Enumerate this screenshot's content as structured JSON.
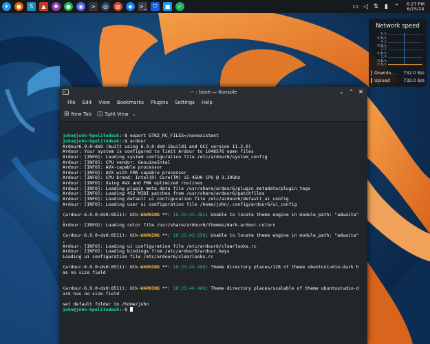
{
  "colors": {
    "accent": "#3daee9",
    "prompt_green": "#1cdc9a",
    "warning": "#fdbc4b",
    "download_swatch": "#3b7fd1",
    "upload_swatch": "#f39c1f"
  },
  "panel": {
    "apps": [
      {
        "name": "kde-logo-icon",
        "glyph": "✦",
        "color": "#1d99f3",
        "square": false
      },
      {
        "name": "firefox-icon",
        "glyph": "●",
        "color": "#e66000",
        "square": false
      },
      {
        "name": "s-app-icon",
        "glyph": "S",
        "color": "#1e8bc3",
        "square": true
      },
      {
        "name": "red-triangle-icon",
        "glyph": "▲",
        "color": "#c0392b",
        "square": true
      },
      {
        "name": "pinwheel-icon",
        "glyph": "✺",
        "color": "#8e44ad",
        "square": false
      },
      {
        "name": "spotify-icon",
        "glyph": "●",
        "color": "#1db954",
        "square": false
      },
      {
        "name": "discord-icon",
        "glyph": "◉",
        "color": "#5865f2",
        "square": false
      },
      {
        "name": "terminal-icon",
        "glyph": ">",
        "color": "#31363b",
        "square": true
      },
      {
        "name": "steam-icon",
        "glyph": "◎",
        "color": "#2a475e",
        "square": false
      },
      {
        "name": "chrome-icon",
        "glyph": "◍",
        "color": "#db4437",
        "square": false
      },
      {
        "name": "thunderbird-icon",
        "glyph": "◆",
        "color": "#0a84ff",
        "square": false
      },
      {
        "name": "konsole-active-icon",
        "glyph": ">_",
        "color": "#3b4046",
        "square": true
      },
      {
        "name": "bitwarden-icon",
        "glyph": "⛉",
        "color": "#175ddc",
        "square": true
      },
      {
        "name": "blue-app-icon",
        "glyph": "■",
        "color": "#1d99f3",
        "square": true
      },
      {
        "name": "green-app-icon",
        "glyph": "✓",
        "color": "#27ae60",
        "square": false
      }
    ],
    "tray": [
      {
        "name": "display-icon",
        "glyph": "▭"
      },
      {
        "name": "volume-icon",
        "glyph": "◁"
      },
      {
        "name": "network-icon",
        "glyph": "⇅"
      },
      {
        "name": "battery-icon",
        "glyph": "▮"
      },
      {
        "name": "expand-tray-icon",
        "glyph": "⌃"
      }
    ],
    "clock_time": "6:27 PM",
    "clock_date": "6/15/24"
  },
  "network_widget": {
    "title": "Network speed",
    "grid_labels": [
      "5.5 KiB/s",
      "4.1 KiB/s",
      "2.7 KiB/s",
      "1.4 KiB/s",
      "0 B/s"
    ],
    "download_label": "Downlo...",
    "download_value": "732.0 B/s",
    "upload_label": "Upload",
    "upload_value": "732.0 B/s"
  },
  "window": {
    "title": "~ : bash — Konsole",
    "menu": [
      "File",
      "Edit",
      "View",
      "Bookmarks",
      "Plugins",
      "Settings",
      "Help"
    ],
    "toolbar": {
      "new_tab": "New Tab",
      "split_view": "Split View"
    }
  },
  "terminal": {
    "lines": [
      [
        {
          "t": "john@john-hpelitedesk",
          "c": "c-green"
        },
        {
          "t": ":",
          "c": "c-white"
        },
        {
          "t": "~",
          "c": "c-blue"
        },
        {
          "t": "$ export GTK2_RC_FILES=/nonexistent",
          "c": "c-white"
        }
      ],
      [
        {
          "t": "john@john-hpelitedesk",
          "c": "c-green"
        },
        {
          "t": ":",
          "c": "c-white"
        },
        {
          "t": "~",
          "c": "c-blue"
        },
        {
          "t": "$ ardour",
          "c": "c-white"
        }
      ],
      [
        {
          "t": "Ardour6.9.0~ds0 (built using 6.9.0-ds0-1build1 and GCC version 11.2.0)",
          "c": "c-white"
        }
      ],
      [
        {
          "t": "Ardour: Your system is configured to limit Ardour to 1048576 open files",
          "c": "c-white"
        }
      ],
      [
        {
          "t": "Ardour: [INFO]: Loading system configuration file /etc/ardour6/system_config",
          "c": "c-white"
        }
      ],
      [
        {
          "t": "Ardour: [INFO]: CPU vendor: GenuineIntel",
          "c": "c-white"
        }
      ],
      [
        {
          "t": "Ardour: [INFO]: AVX-capable processor",
          "c": "c-white"
        }
      ],
      [
        {
          "t": "Ardour: [INFO]: AVX with FMA capable processor",
          "c": "c-white"
        }
      ],
      [
        {
          "t": "Ardour: [INFO]: CPU brand: Intel(R) Core(TM) i5-4590 CPU @ 3.30GHz",
          "c": "c-white"
        }
      ],
      [
        {
          "t": "Ardour: [INFO]: Using AVX and FMA optimized routines",
          "c": "c-white"
        }
      ],
      [
        {
          "t": "Ardour: [INFO]: Loading plugin meta data file /usr/share/ardour6/plugin_metadata/plugin_tags",
          "c": "c-white"
        }
      ],
      [
        {
          "t": "Ardour: [INFO]: Loading 452 MIDI patches from /usr/share/ardour6/patchfiles",
          "c": "c-white"
        }
      ],
      [
        {
          "t": "Ardour: [INFO]: Loading default ui configuration file /etc/ardour6/default_ui_config",
          "c": "c-white"
        }
      ],
      [
        {
          "t": "Ardour: [INFO]: Loading user ui configuration file /home/john/.config/ardour6/ui_config",
          "c": "c-white"
        }
      ],
      [
        {
          "t": "",
          "c": "c-white"
        }
      ],
      [
        {
          "t": "(ardour-6.9.0~ds0:8511): Gtk-",
          "c": "c-white"
        },
        {
          "t": "WARNING",
          "c": "c-warn"
        },
        {
          "t": " **: ",
          "c": "c-white"
        },
        {
          "t": "18:25:43.461",
          "c": "c-cyan"
        },
        {
          "t": ": Unable to locate theme engine in module_path: \"adwaita\"",
          "c": "c-white"
        }
      ],
      [
        {
          "t": ",",
          "c": "c-white"
        }
      ],
      [
        {
          "t": "Ardour: [INFO]: Loading color file /usr/share/ardour6/themes/dark-ardour.colors",
          "c": "c-white"
        }
      ],
      [
        {
          "t": "",
          "c": "c-white"
        }
      ],
      [
        {
          "t": "(ardour-6.9.0~ds0:8511): Gtk-",
          "c": "c-white"
        },
        {
          "t": "WARNING",
          "c": "c-warn"
        },
        {
          "t": " **: ",
          "c": "c-white"
        },
        {
          "t": "18:25:43.658",
          "c": "c-cyan"
        },
        {
          "t": ": Unable to locate theme engine in module_path: \"adwaita\"",
          "c": "c-white"
        }
      ],
      [
        {
          "t": ",",
          "c": "c-white"
        }
      ],
      [
        {
          "t": "Ardour: [INFO]: Loading ui configuration file /etc/ardour6/clearlooks.rc",
          "c": "c-white"
        }
      ],
      [
        {
          "t": "Ardour: [INFO]: Loading bindings from /etc/ardour6/ardour.keys",
          "c": "c-white"
        }
      ],
      [
        {
          "t": "Loading ui configuration file /etc/ardour6/clearlooks.rc",
          "c": "c-white"
        }
      ],
      [
        {
          "t": "",
          "c": "c-white"
        }
      ],
      [
        {
          "t": "(ardour-6.9.0~ds0:8511): Gtk-",
          "c": "c-white"
        },
        {
          "t": "WARNING",
          "c": "c-warn"
        },
        {
          "t": " **: ",
          "c": "c-white"
        },
        {
          "t": "18:25:44.468",
          "c": "c-cyan"
        },
        {
          "t": ": Theme directory places/128 of theme ubuntustudio-dark h",
          "c": "c-white"
        }
      ],
      [
        {
          "t": "as no size field",
          "c": "c-white"
        }
      ],
      [
        {
          "t": "",
          "c": "c-white"
        }
      ],
      [
        {
          "t": "",
          "c": "c-white"
        }
      ],
      [
        {
          "t": "(ardour-6.9.0~ds0:8511): Gtk-",
          "c": "c-white"
        },
        {
          "t": "WARNING",
          "c": "c-warn"
        },
        {
          "t": " **: ",
          "c": "c-white"
        },
        {
          "t": "18:25:44.468",
          "c": "c-cyan"
        },
        {
          "t": ": Theme directory places/scalable of theme ubuntustudio-d",
          "c": "c-white"
        }
      ],
      [
        {
          "t": "ark has no size field",
          "c": "c-white"
        }
      ],
      [
        {
          "t": "",
          "c": "c-white"
        }
      ],
      [
        {
          "t": "set default folder to /home/john",
          "c": "c-white"
        }
      ],
      [
        {
          "t": "john@john-hpelitedesk",
          "c": "c-green"
        },
        {
          "t": ":",
          "c": "c-white"
        },
        {
          "t": "~",
          "c": "c-blue"
        },
        {
          "t": "$ ",
          "c": "c-white"
        }
      ]
    ]
  }
}
